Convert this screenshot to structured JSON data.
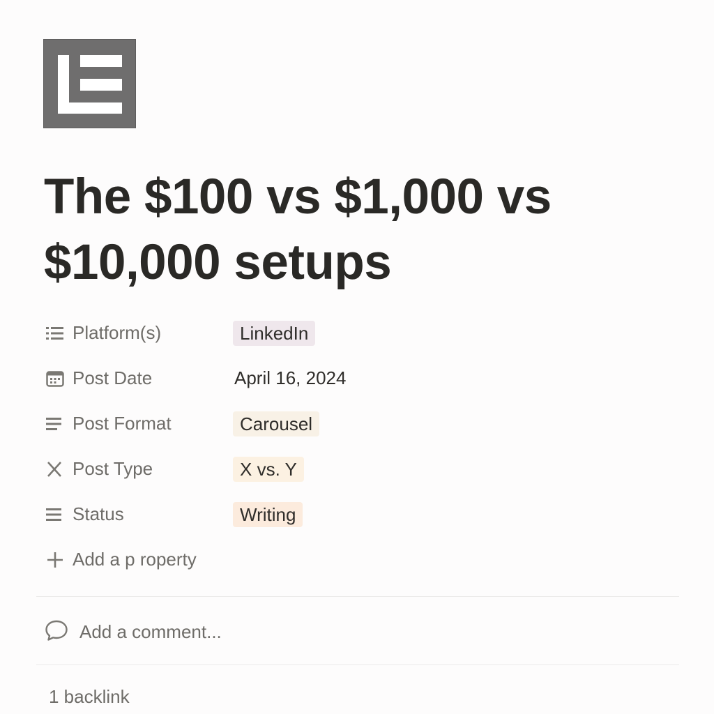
{
  "page": {
    "icon": "page-layout-icon",
    "title": "The $100 vs $1,000 vs $10,000 setups"
  },
  "properties": [
    {
      "icon": "list-icon",
      "label": "Platform(s)",
      "value": "LinkedIn",
      "type": "tag",
      "tag_color": "#efe7ec"
    },
    {
      "icon": "calendar-icon",
      "label": "Post Date",
      "value": "April 16, 2024",
      "type": "text"
    },
    {
      "icon": "select-icon",
      "label": "Post Format",
      "value": "Carousel",
      "type": "tag",
      "tag_color": "#f8f1e6"
    },
    {
      "icon": "x-icon",
      "label": "Post Type",
      "value": "X vs. Y",
      "type": "tag",
      "tag_color": "#fcf1e2"
    },
    {
      "icon": "status-icon",
      "label": "Status",
      "value": "Writing",
      "type": "tag",
      "tag_color": "#fcebdd"
    }
  ],
  "add_property": {
    "icon": "plus-icon",
    "label": "Add a p roperty"
  },
  "comment": {
    "icon": "comment-bubble-icon",
    "placeholder": "Add a comment..."
  },
  "backlinks": {
    "label": "1 backlink"
  }
}
